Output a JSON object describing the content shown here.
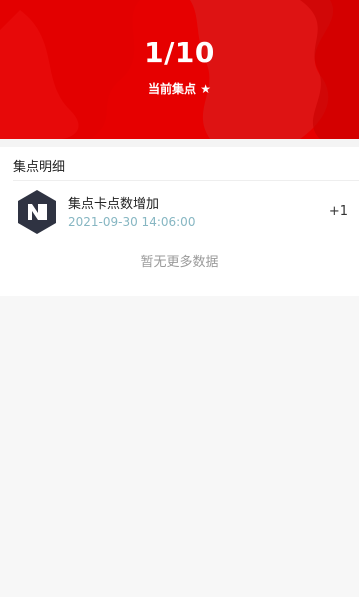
{
  "header": {
    "count_text": "1/10",
    "subtitle": "当前集点",
    "star_icon": "★",
    "colors": {
      "primary": "#e50000",
      "secondary": "#d81a1a",
      "text": "#ffffff"
    }
  },
  "details": {
    "section_title": "集点明细",
    "records": [
      {
        "name": "集点卡点数增加",
        "time": "2021-09-30 14:06:00",
        "delta": "+1",
        "icon": "hexagon-n-logo-icon"
      }
    ],
    "empty_text": "暂无更多数据"
  }
}
